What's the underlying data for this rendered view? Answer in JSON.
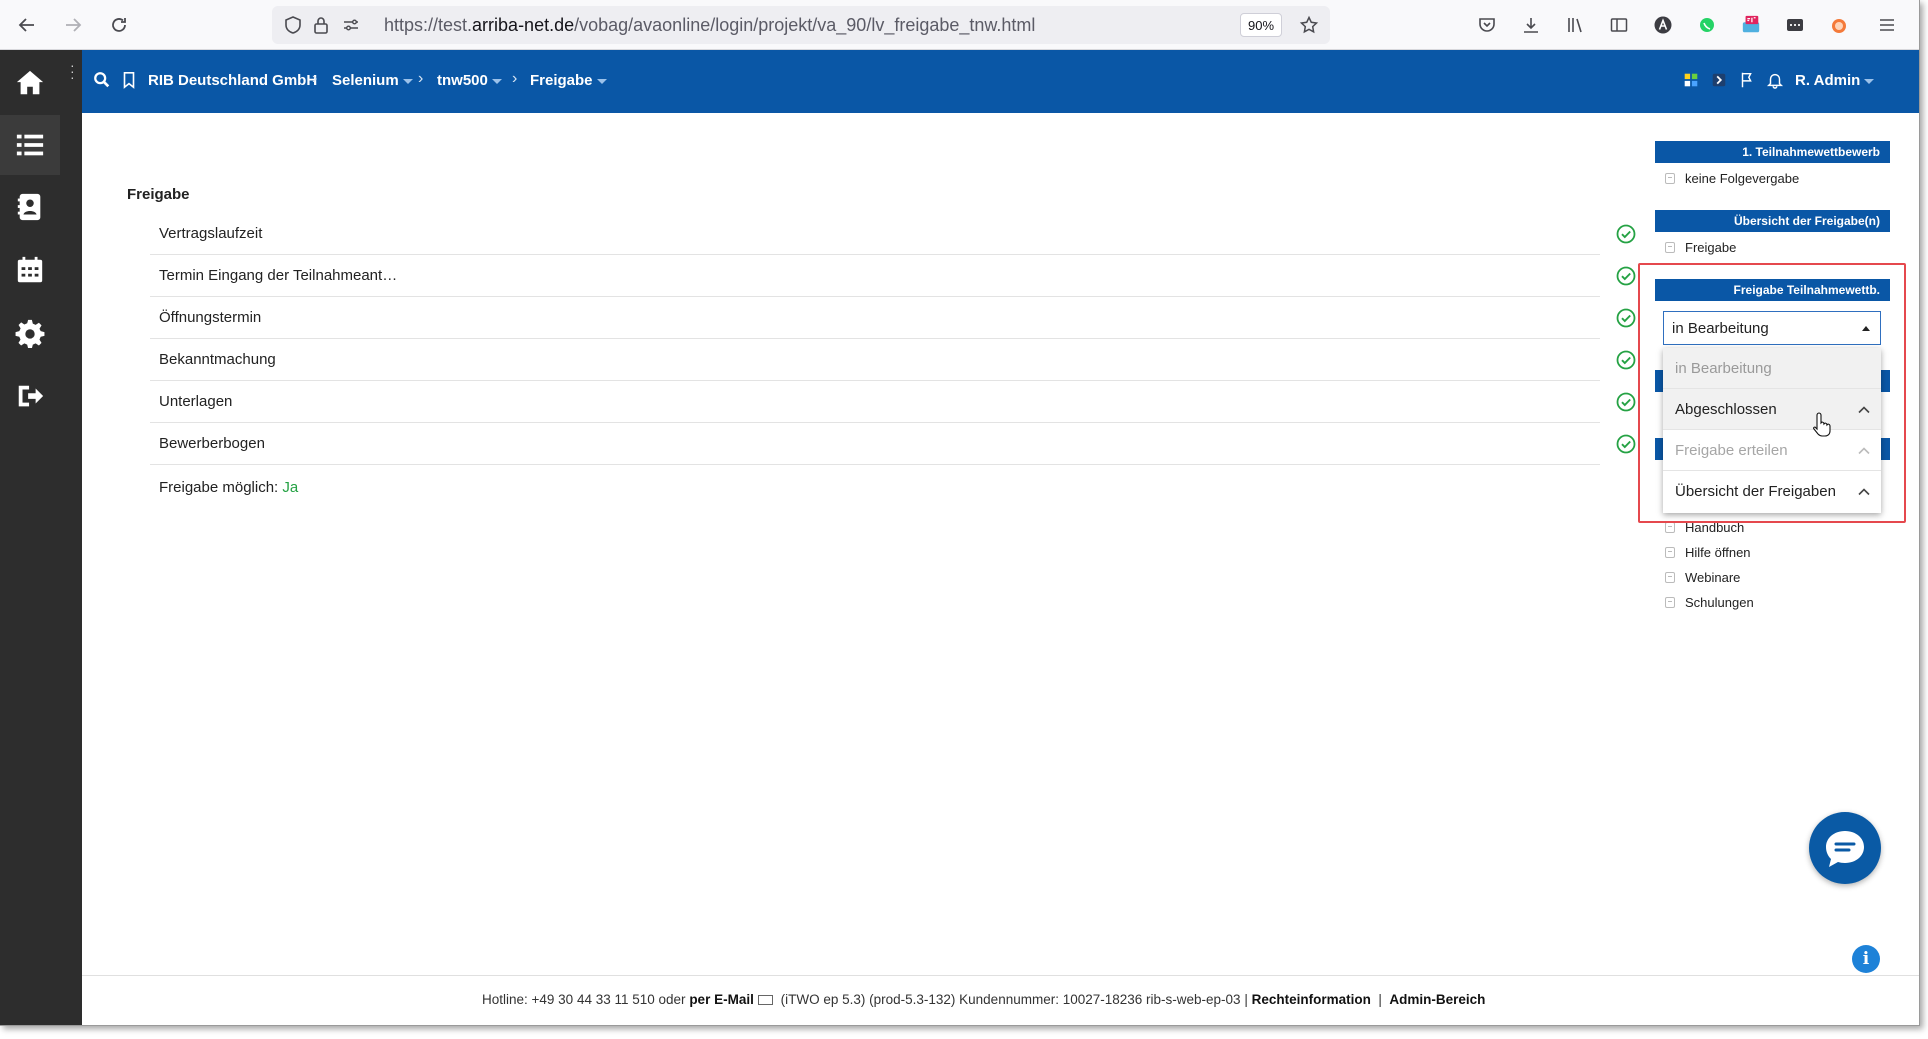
{
  "browser": {
    "url_prefix": "https://test.",
    "url_host": "arriba-net.de",
    "url_path": "/vobag/avaonline/login/projekt/va_90/lv_freigabe_tnw.html",
    "zoom": "90%"
  },
  "header": {
    "breadcrumbs": [
      {
        "label": "RIB Deutschland GmbH"
      },
      {
        "label": "Selenium"
      },
      {
        "label": "tnw500"
      },
      {
        "label": "Freigabe"
      }
    ],
    "user": "R. Admin"
  },
  "main": {
    "section_title": "Freigabe",
    "rows": [
      {
        "label": "Vertragslaufzeit"
      },
      {
        "label": "Termin Eingang der Teilnahmeant…"
      },
      {
        "label": "Öffnungstermin"
      },
      {
        "label": "Bekanntmachung"
      },
      {
        "label": "Unterlagen"
      },
      {
        "label": "Bewerberbogen"
      }
    ],
    "status_label": "Freigabe möglich:",
    "status_value": "Ja"
  },
  "right_panel": {
    "head1": "1. Teilnahmewettbewerb",
    "link1": "keine Folgevergabe",
    "head2": "Übersicht der Freigabe(n)",
    "link2": "Freigabe",
    "head3": "Freigabe Teilnahmewettb.",
    "select_value": "in Bearbeitung",
    "dropdown_options": [
      {
        "label": "in Bearbeitung"
      },
      {
        "label": "Abgeschlossen"
      },
      {
        "label": "Freigabe erteilen"
      },
      {
        "label": "Übersicht der Freigaben"
      }
    ],
    "help_links": [
      {
        "label": "Handbuch"
      },
      {
        "label": "Hilfe öffnen"
      },
      {
        "label": "Webinare"
      },
      {
        "label": "Schulungen"
      }
    ]
  },
  "footer": {
    "hotline": "Hotline: +49 30 44 33 11 510 oder",
    "email_link": "per E-Mail",
    "version": "(iTWO ep 5.3) (prod-5.3-132)   Kundennummer: 10027-18236 rib-s-web-ep-03 |",
    "legal_link": "Rechteinformation",
    "separator": "|",
    "admin_link": "Admin-Bereich"
  },
  "colors": {
    "header_blue": "#0a57a6",
    "sidebar_dark": "#2d2d2d",
    "check_green": "#25a244",
    "highlight_red": "#e5484d"
  }
}
